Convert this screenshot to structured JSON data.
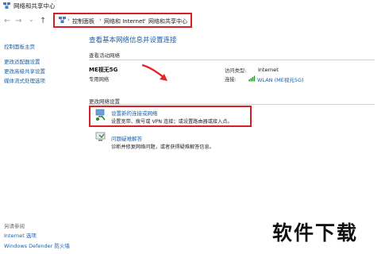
{
  "window": {
    "title": "网络和共享中心"
  },
  "nav": {
    "back": "←",
    "forward": "→",
    "down": "⌄",
    "up": "↑"
  },
  "breadcrumb": [
    "控制面板",
    "网络和 Internet",
    "网络和共享中心"
  ],
  "sidebar": {
    "items": [
      {
        "label": "控制面板主页"
      },
      {
        "label": "更改适配器设置"
      },
      {
        "label": "更改高级共享设置"
      },
      {
        "label": "媒体流式处理选项"
      }
    ],
    "see_also_heading": "另请参阅",
    "see_also": [
      {
        "label": "Internet 选项"
      },
      {
        "label": "Windows Defender 防火墙"
      }
    ]
  },
  "main": {
    "title": "查看基本网络信息并设置连接",
    "active_networks_heading": "查看活动网络",
    "network": {
      "name": "ME视无5G",
      "type": "专用网络",
      "access_type_label": "访问类型:",
      "access_type_value": "Internet",
      "connections_label": "连接:",
      "connection_value": "WLAN (ME视元5G)"
    },
    "change_settings_heading": "更改网络设置",
    "tasks": [
      {
        "link": "设置新的连接或网络",
        "desc": "设置宽带、拨号或 VPN 连接；或设置路由器或接入点。"
      },
      {
        "link": "问题疑难解答",
        "desc": "诊断并修复网络问题，或者获得疑难解答信息。"
      }
    ]
  },
  "watermark": "软件下载",
  "colors": {
    "accent_link": "#1a5fa8",
    "highlight": "#d81f26",
    "arrow": "#e0252b"
  }
}
